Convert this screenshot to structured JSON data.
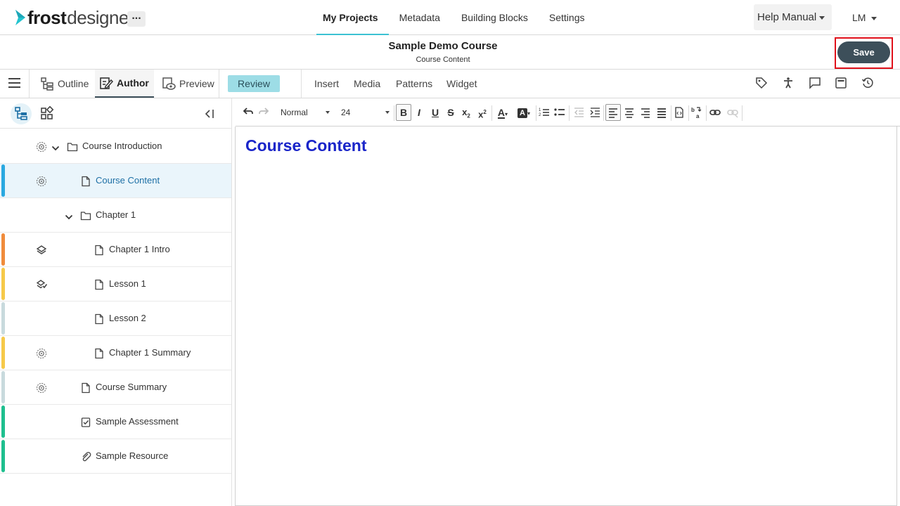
{
  "header": {
    "logo_part1": "frost",
    "logo_part2": "designer",
    "more_label": "...",
    "nav": [
      {
        "label": "My Projects",
        "active": true
      },
      {
        "label": "Metadata",
        "active": false
      },
      {
        "label": "Building Blocks",
        "active": false
      },
      {
        "label": "Settings",
        "active": false
      }
    ],
    "help_label": "Help Manual",
    "user_initials": "LM"
  },
  "titlebar": {
    "title": "Sample Demo Course",
    "subtitle": "Course Content",
    "save_label": "Save"
  },
  "modes": {
    "outline_label": "Outline",
    "author_label": "Author",
    "preview_label": "Preview",
    "review_label": "Review",
    "menus": [
      "Insert",
      "Media",
      "Patterns",
      "Widget"
    ],
    "right_icons": [
      "tag-icon",
      "accessibility-icon",
      "comment-icon",
      "window-icon",
      "history-icon"
    ]
  },
  "editor": {
    "style_value": "Normal",
    "size_value": "24",
    "heading": "Course Content"
  },
  "tree": [
    {
      "label": "Course Introduction",
      "type": "folder",
      "expanded": true,
      "status": "gear",
      "bar_color": "",
      "selected": false
    },
    {
      "label": "Course Content",
      "type": "page",
      "status": "gear",
      "bar_color": "#2aa8e0",
      "selected": true
    },
    {
      "label": "Chapter 1",
      "type": "folder",
      "expanded": true,
      "status": "",
      "bar_color": "",
      "selected": false
    },
    {
      "label": "Chapter 1 Intro",
      "type": "page",
      "status": "layers",
      "bar_color": "#f08c3c",
      "selected": false
    },
    {
      "label": "Lesson 1",
      "type": "page",
      "status": "layers-check",
      "bar_color": "#f6c94a",
      "selected": false
    },
    {
      "label": "Lesson 2",
      "type": "page",
      "status": "",
      "bar_color": "#c8dadd",
      "selected": false
    },
    {
      "label": "Chapter 1 Summary",
      "type": "page",
      "status": "gear",
      "bar_color": "#f6c94a",
      "selected": false
    },
    {
      "label": "Course Summary",
      "type": "page",
      "status": "gear",
      "bar_color": "#c8dadd",
      "selected": false
    },
    {
      "label": "Sample Assessment",
      "type": "assessment",
      "status": "",
      "bar_color": "#1fbf8f",
      "selected": false
    },
    {
      "label": "Sample Resource",
      "type": "resource",
      "status": "",
      "bar_color": "#1fbf8f",
      "selected": false
    }
  ]
}
